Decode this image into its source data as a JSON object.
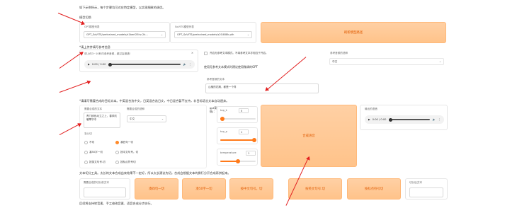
{
  "top_note": "如下示例所示，每个步骤均可对应特定模型，以实现细致的调优。",
  "model_section": {
    "title": "模型切换",
    "gpt_label": "GPT模型列表",
    "gpt_value": "GPT_SoVITS/pretrained_models/s1bert25hz-2k...",
    "sovits_label": "SoVITS模型列表",
    "sovits_value": "GPT_SoVITS/pretrained_models/s2G488k.pth",
    "refresh_label": "刷新模型路径"
  },
  "ref_section": {
    "title": "*请上传并填写参考信息",
    "audio_hint": "请上传3~10秒内参考音频，超过会报错！",
    "time": "0:00 / 0:00",
    "no_ref_label": "开启无参考文本模式。不填参考文本亦相当于开启。",
    "no_ref_note": "使用无参考文本模式时建议使用微调的GPT",
    "ref_text_label": "参考音频的文本",
    "ref_text_value": "山楂的花期，都是一个样",
    "ref_lang_label": "参考音频的语种",
    "ref_lang_value": "中文"
  },
  "synth_section": {
    "title": "*请填写需要合成的目标文本。中英混合选中文，日英混合选日文，中日混合暂不支持，非目标语言文本自动遗弃。",
    "target_text_label": "需要合成的文本",
    "target_text_value": "青门柳色动立之上，春风吹暖翠华中",
    "target_lang_label": "需要合成的语种",
    "target_lang_value": "中文",
    "split_label": "怎么切",
    "split_options": [
      "不切",
      "凑四句一切",
      "凑50字一切",
      "按中文句号。切",
      "按英文句号.切",
      "按标点符号切"
    ],
    "gpt_note": "gpt采样参数(无参考文本时不要太低)：",
    "top_k_label": "top_k",
    "top_k_value": "5",
    "top_k_fraction": 0.05,
    "top_p_label": "top_p",
    "top_p_value": "1",
    "top_p_fraction": 1.0,
    "temperature_label": "temperature",
    "temperature_value": "1",
    "temperature_fraction": 0.5,
    "synth_button": "合成语音",
    "output_label": "输出的语音",
    "output_time": "0:00 / 0:00"
  },
  "tools_section": {
    "title": "文本切分工具。太长的文本合成出来效果不一定好，所以太长建议先切。合成会根据文本的换行分开合成再拼起来。",
    "input_label": "需要合成的切分前文本",
    "buttons": [
      "凑四句一切",
      "凑50字一切",
      "按中文句号。切",
      "按英文句号.切",
      "按标点符号切"
    ],
    "output_label": "切分后文本"
  },
  "footer_note": "后续将支持转音素、手工修改音素、语音合成分步执行。"
}
